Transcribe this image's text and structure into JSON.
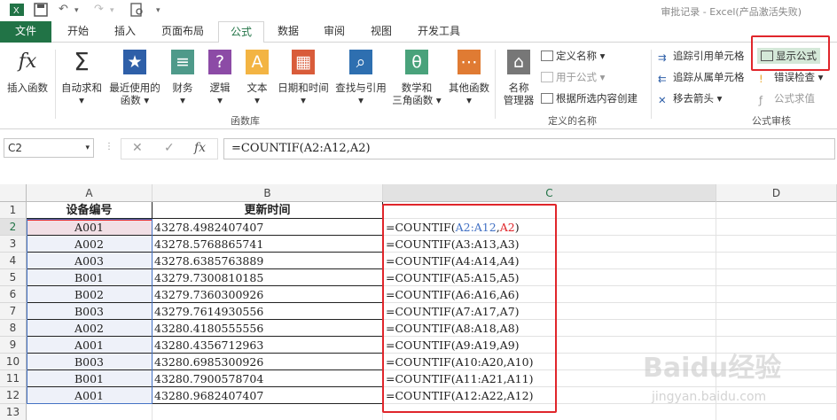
{
  "window": {
    "title": "审批记录 - Excel(产品激活失败)"
  },
  "tabs": [
    "文件",
    "开始",
    "插入",
    "页面布局",
    "公式",
    "数据",
    "审阅",
    "视图",
    "开发工具"
  ],
  "active_tab": "公式",
  "ribbon": {
    "insert_function": "插入函数",
    "autosum": "自动求和",
    "recent": "最近使用的",
    "recent2": "函数",
    "finance": "财务",
    "logic": "逻辑",
    "text": "文本",
    "datetime": "日期和时间",
    "lookup": "查找与引用",
    "math": "数学和",
    "math2": "三角函数",
    "other": "其他函数",
    "library_label": "函数库",
    "name_manager": "名称",
    "name_manager2": "管理器",
    "define_name": "定义名称",
    "use_in_formula": "用于公式",
    "create_from_selection": "根据所选内容创建",
    "defined_names_label": "定义的名称",
    "trace_precedents": "追踪引用单元格",
    "trace_dependents": "追踪从属单元格",
    "remove_arrows": "移去箭头",
    "show_formulas": "显示公式",
    "error_check": "错误检查",
    "evaluate": "公式求值",
    "audit_label": "公式审核"
  },
  "formula_bar": {
    "name_box": "C2",
    "fx": "fx",
    "formula": "=COUNTIF(A2:A12,A2)"
  },
  "columns": [
    "A",
    "B",
    "C",
    "D"
  ],
  "rows": [
    "1",
    "2",
    "3",
    "4",
    "5",
    "6",
    "7",
    "8",
    "9",
    "10",
    "11",
    "12",
    "13"
  ],
  "headers": {
    "a": "设备编号",
    "b": "更新时间"
  },
  "data": [
    {
      "a": "A001",
      "b": "43278.4982407407",
      "c": "=COUNTIF(A2:A12,A2)"
    },
    {
      "a": "A002",
      "b": "43278.5768865741",
      "c": "=COUNTIF(A3:A13,A3)"
    },
    {
      "a": "A003",
      "b": "43278.6385763889",
      "c": "=COUNTIF(A4:A14,A4)"
    },
    {
      "a": "B001",
      "b": "43279.7300810185",
      "c": "=COUNTIF(A5:A15,A5)"
    },
    {
      "a": "B002",
      "b": "43279.7360300926",
      "c": "=COUNTIF(A6:A16,A6)"
    },
    {
      "a": "B003",
      "b": "43279.7614930556",
      "c": "=COUNTIF(A7:A17,A7)"
    },
    {
      "a": "A002",
      "b": "43280.4180555556",
      "c": "=COUNTIF(A8:A18,A8)"
    },
    {
      "a": "A001",
      "b": "43280.4356712963",
      "c": "=COUNTIF(A9:A19,A9)"
    },
    {
      "a": "B003",
      "b": "43280.6985300926",
      "c": "=COUNTIF(A10:A20,A10)"
    },
    {
      "a": "B001",
      "b": "43280.7900578704",
      "c": "=COUNTIF(A11:A21,A11)"
    },
    {
      "a": "A001",
      "b": "43280.9682407407",
      "c": "=COUNTIF(A12:A22,A12)"
    }
  ],
  "c2_parts": {
    "pre": "=COUNTIF(",
    "range": "A2:A12",
    ",": ",",
    "ref": "A2",
    "post": ")"
  },
  "colors": {
    "accent": "#217346",
    "highlight": "#e0262b",
    "range_blue": "#4472c4"
  },
  "watermark": {
    "text": "Baidu经验",
    "sub": "jingyan.baidu.com"
  }
}
